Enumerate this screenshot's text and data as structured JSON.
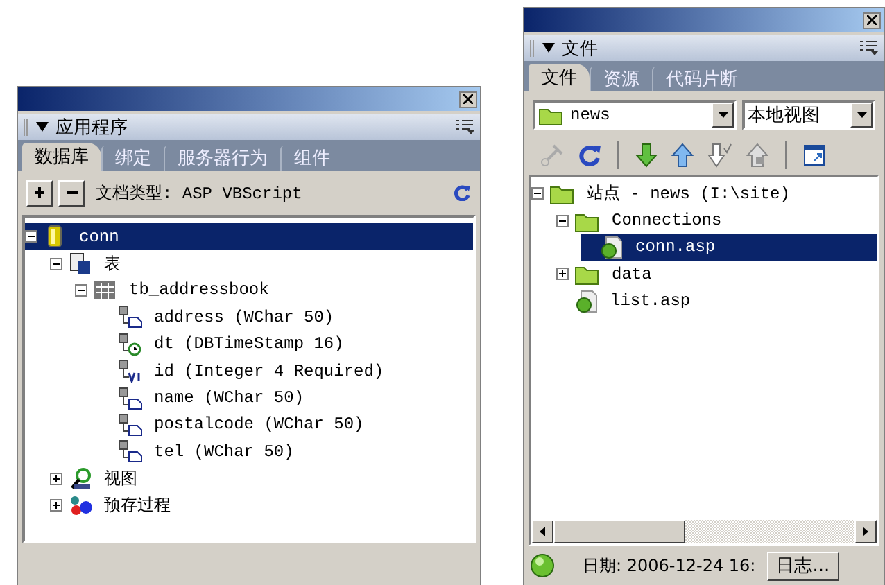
{
  "application_panel": {
    "title": "应用程序",
    "tabs": [
      {
        "label": "数据库",
        "selected": true
      },
      {
        "label": "绑定",
        "selected": false
      },
      {
        "label": "服务器行为",
        "selected": false
      },
      {
        "label": "组件",
        "selected": false
      }
    ],
    "document_type": "文档类型: ASP VBScript",
    "tree": [
      {
        "label": "conn",
        "kind": "database",
        "expanded": true,
        "selected": true,
        "children": [
          {
            "label": "表",
            "kind": "tables",
            "expanded": true,
            "selected": false,
            "children": [
              {
                "label": "tb_addressbook",
                "kind": "table",
                "expanded": true,
                "selected": false,
                "children": [
                  {
                    "label": "address (WChar 50)",
                    "kind": "text",
                    "selected": false
                  },
                  {
                    "label": "dt (DBTimeStamp 16)",
                    "kind": "date",
                    "selected": false
                  },
                  {
                    "label": "id (Integer 4 Required)",
                    "kind": "number",
                    "selected": false
                  },
                  {
                    "label": "name (WChar 50)",
                    "kind": "text",
                    "selected": false
                  },
                  {
                    "label": "postalcode (WChar 50)",
                    "kind": "text",
                    "selected": false
                  },
                  {
                    "label": "tel (WChar 50)",
                    "kind": "text",
                    "selected": false
                  }
                ]
              }
            ]
          },
          {
            "label": "视图",
            "kind": "view",
            "expanded": false,
            "selected": false
          },
          {
            "label": "预存过程",
            "kind": "procedures",
            "expanded": false,
            "selected": false
          }
        ]
      }
    ]
  },
  "files_panel": {
    "title": "文件",
    "tabs": [
      {
        "label": "文件",
        "selected": true
      },
      {
        "label": "资源",
        "selected": false
      },
      {
        "label": "代码片断",
        "selected": false
      }
    ],
    "site_select": "news",
    "view_select": "本地视图",
    "tree": [
      {
        "label": "站点 - news (I:\\site)",
        "kind": "site",
        "expanded": true,
        "selected": false,
        "children": [
          {
            "label": "Connections",
            "kind": "folder",
            "expanded": true,
            "selected": false,
            "children": [
              {
                "label": "conn.asp",
                "kind": "asp",
                "selected": true
              }
            ]
          },
          {
            "label": "data",
            "kind": "folder",
            "expanded": false,
            "selected": false
          },
          {
            "label": "list.asp",
            "kind": "asp",
            "selected": false
          }
        ]
      }
    ],
    "status_text": "日期: 2006-12-24 16:",
    "log_button": "日志..."
  }
}
